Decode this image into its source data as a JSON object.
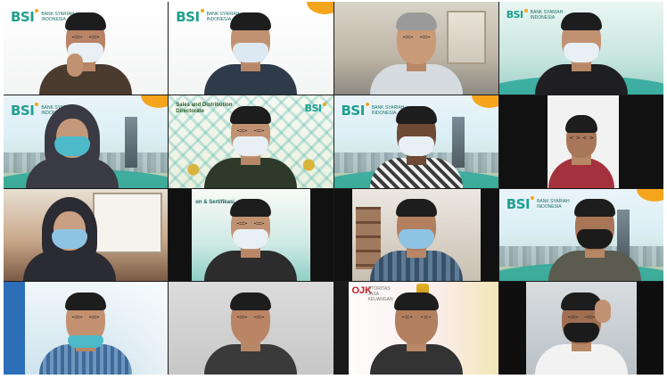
{
  "meeting": {
    "tiles": [
      {
        "id": "p1",
        "logo": "BSI",
        "logo_sub": "BANK SYARIAH INDONESIA"
      },
      {
        "id": "p2",
        "logo": "BSI",
        "logo_sub": "BANK SYARIAH INDONESIA"
      },
      {
        "id": "p3"
      },
      {
        "id": "p4",
        "logo": "BSI",
        "logo_sub": "BANK SYARIAH INDONESIA"
      },
      {
        "id": "p5",
        "logo": "BSI",
        "logo_sub": "BANK SYARIAH INDONESIA"
      },
      {
        "id": "p6",
        "banner": "Sales and Distribution Directorate",
        "logo": "BSI",
        "logo_sub": "BANK SYARIAH INDONESIA"
      },
      {
        "id": "p7",
        "logo": "BSI",
        "logo_sub": "BANK SYARIAH INDONESIA"
      },
      {
        "id": "p8"
      },
      {
        "id": "p9"
      },
      {
        "id": "p10",
        "banner": "on & Sertifikasi"
      },
      {
        "id": "p11"
      },
      {
        "id": "p12",
        "logo": "BSI",
        "logo_sub": "BANK SYARIAH INDONESIA"
      },
      {
        "id": "p13"
      },
      {
        "id": "p14"
      },
      {
        "id": "p15",
        "logo": "OJK",
        "logo_sub": "OTORITAS JASA KEUANGAN"
      },
      {
        "id": "p16"
      }
    ]
  },
  "colors": {
    "bsi_green": "#1fa08f",
    "bsi_orange": "#f4a51c",
    "ojk_red": "#c01d23"
  }
}
